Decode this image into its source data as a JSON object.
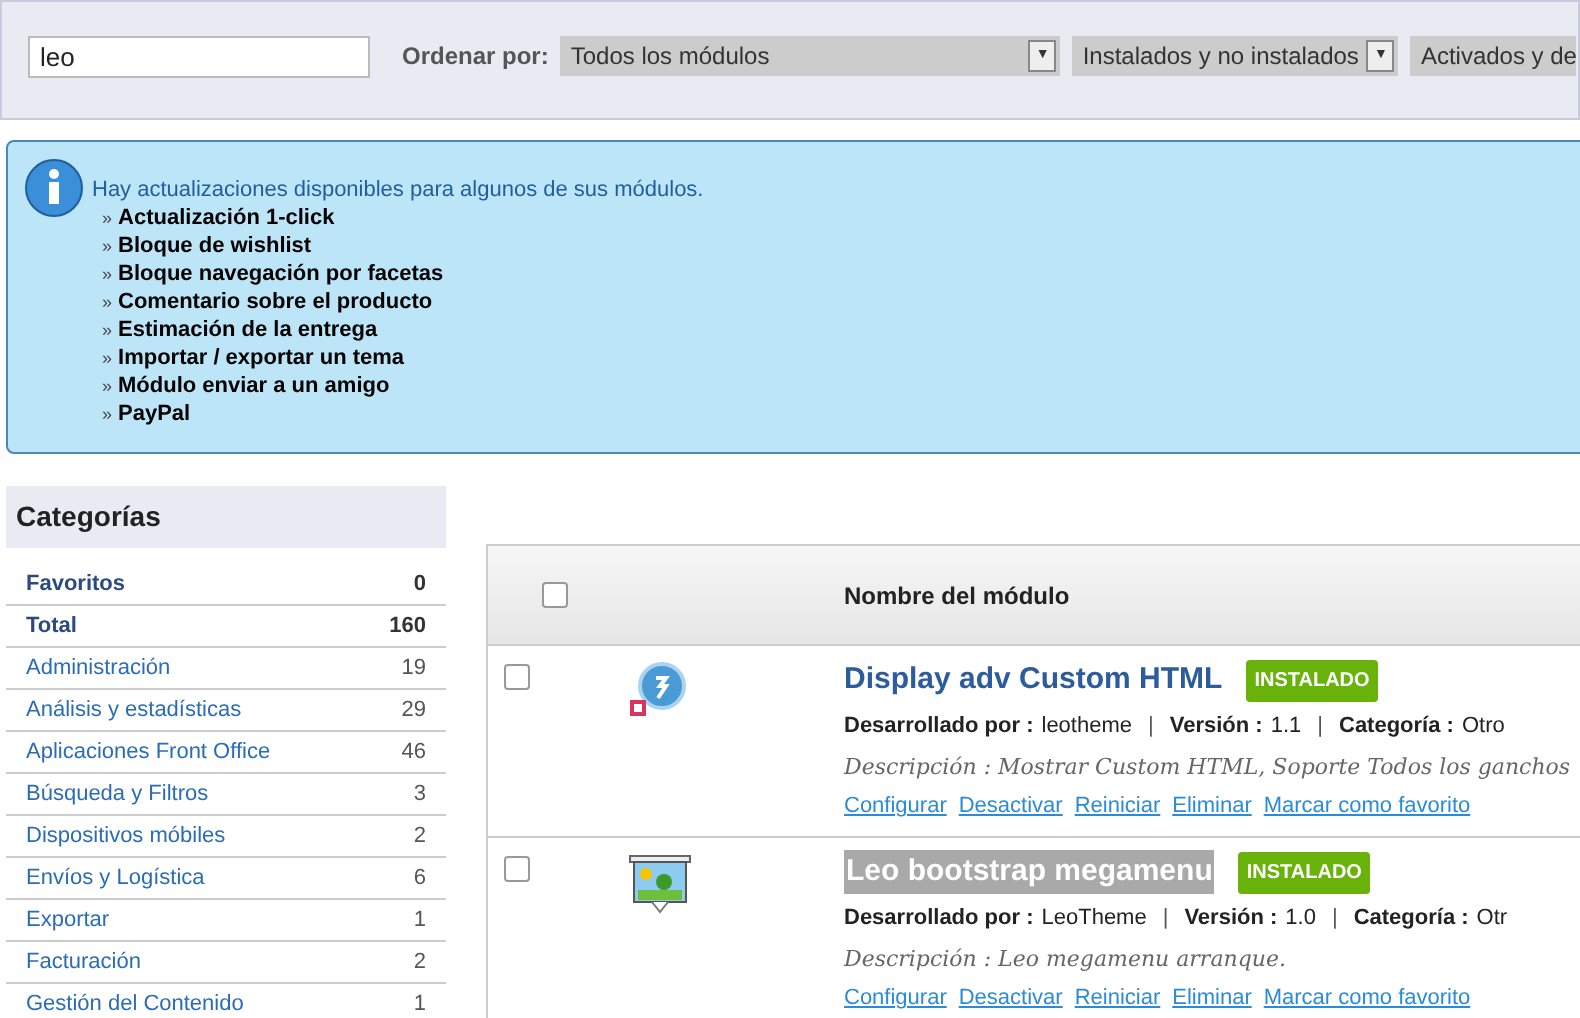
{
  "filter_bar": {
    "search": {
      "value": "leo"
    },
    "sort_label": "Ordenar por:",
    "selects": [
      {
        "value": "Todos los módulos",
        "arrow": "▼"
      },
      {
        "value": "Instalados y no instalados",
        "arrow": "▼"
      },
      {
        "value": "Activados y de"
      }
    ]
  },
  "notice": {
    "message": "Hay actualizaciones disponibles para algunos de sus módulos.",
    "items": [
      {
        "marker": "»",
        "label": "Actualización 1-click"
      },
      {
        "marker": "»",
        "label": "Bloque de wishlist"
      },
      {
        "marker": "»",
        "label": "Bloque navegación por facetas"
      },
      {
        "marker": "»",
        "label": "Comentario sobre el producto"
      },
      {
        "marker": "»",
        "label": "Estimación de la entrega"
      },
      {
        "marker": "»",
        "label": "Importar / exportar un tema"
      },
      {
        "marker": "»",
        "label": "Módulo enviar a un amigo"
      },
      {
        "marker": "»",
        "label": "PayPal"
      }
    ]
  },
  "sidebar": {
    "title": "Categorías",
    "items": [
      {
        "kind": "summary",
        "label": "Favoritos",
        "count": "0"
      },
      {
        "kind": "summary",
        "label": "Total",
        "count": "160"
      },
      {
        "kind": "category",
        "label": "Administración",
        "count": "19"
      },
      {
        "kind": "category",
        "label": "Análisis y estadísticas",
        "count": "29"
      },
      {
        "kind": "category",
        "label": "Aplicaciones Front Office",
        "count": "46"
      },
      {
        "kind": "category",
        "label": "Búsqueda y Filtros",
        "count": "3"
      },
      {
        "kind": "category",
        "label": "Dispositivos móbiles",
        "count": "2"
      },
      {
        "kind": "category",
        "label": "Envíos y Logística",
        "count": "6"
      },
      {
        "kind": "category",
        "label": "Exportar",
        "count": "1"
      },
      {
        "kind": "category",
        "label": "Facturación",
        "count": "2"
      },
      {
        "kind": "category",
        "label": "Gestión del Contenido",
        "count": "1"
      }
    ]
  },
  "table": {
    "select_all_checked": false,
    "column_header": "Nombre del módulo",
    "rows": [
      {
        "checked": false,
        "kind": "globe",
        "name": "Display adv Custom HTML",
        "highlighted": false,
        "status": "INSTALADO",
        "author_label": "Desarrollado por :",
        "author": "leotheme",
        "separator_1": "|",
        "separator_2": "|",
        "version_label": "Versión :",
        "version": "1.1",
        "category_label": "Categoría :",
        "category": "Otro",
        "description": "Descripción : Mostrar Custom HTML, Soporte Todos los ganchos",
        "actions": [
          "Configurar",
          "Desactivar",
          "Reiniciar",
          "Eliminar",
          "Marcar como favorito"
        ]
      },
      {
        "checked": false,
        "kind": "screen",
        "name": "Leo bootstrap megamenu",
        "highlighted": true,
        "status": "INSTALADO",
        "author_label": "Desarrollado por :",
        "author": "LeoTheme",
        "separator_1": "|",
        "separator_2": "|",
        "version_label": "Versión :",
        "version": "1.0",
        "category_label": "Categoría :",
        "category": "Otr",
        "description": "Descripción : Leo megamenu arranque.",
        "actions": [
          "Configurar",
          "Desactivar",
          "Reiniciar",
          "Eliminar",
          "Marcar como favorito"
        ]
      }
    ]
  }
}
